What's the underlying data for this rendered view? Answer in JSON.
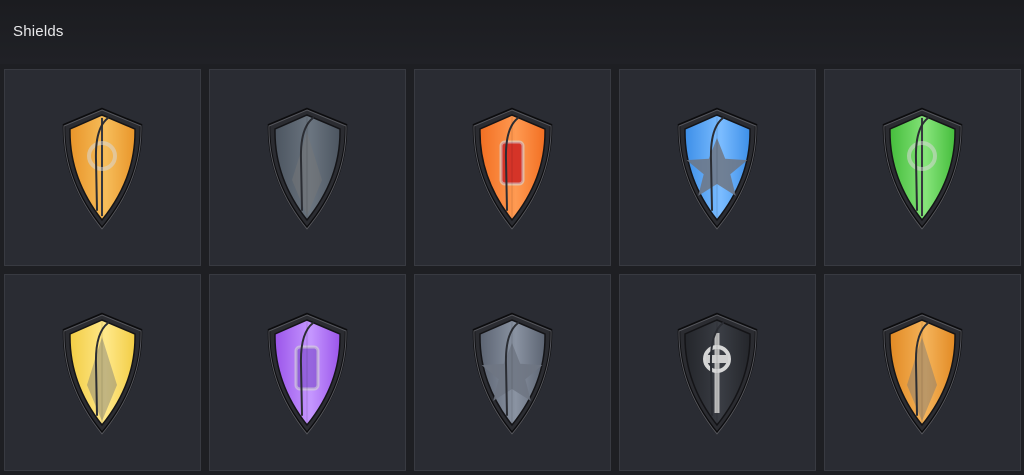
{
  "header": {
    "title": "Shields"
  },
  "shields": [
    {
      "fill": "#e9952a",
      "light": "#f6bd5a",
      "emblem": "ring"
    },
    {
      "fill": "#4c5560",
      "light": "#6b7580",
      "emblem": "spike"
    },
    {
      "fill": "#f26f22",
      "light": "#ff9a52",
      "emblem": "rect-red"
    },
    {
      "fill": "#3d8fe8",
      "light": "#7bbcff",
      "emblem": "star"
    },
    {
      "fill": "#45bd3c",
      "light": "#86e47a",
      "emblem": "ring"
    },
    {
      "fill": "#f2cd45",
      "light": "#ffe88a",
      "emblem": "spike"
    },
    {
      "fill": "#9b55ea",
      "light": "#c597ff",
      "emblem": "rect"
    },
    {
      "fill": "#5c6472",
      "light": "#8a93a2",
      "emblem": "star"
    },
    {
      "fill": "#24262b",
      "light": "#3a3d44",
      "emblem": "white-mace"
    },
    {
      "fill": "#e28a24",
      "light": "#f4b35a",
      "emblem": "spike"
    }
  ]
}
